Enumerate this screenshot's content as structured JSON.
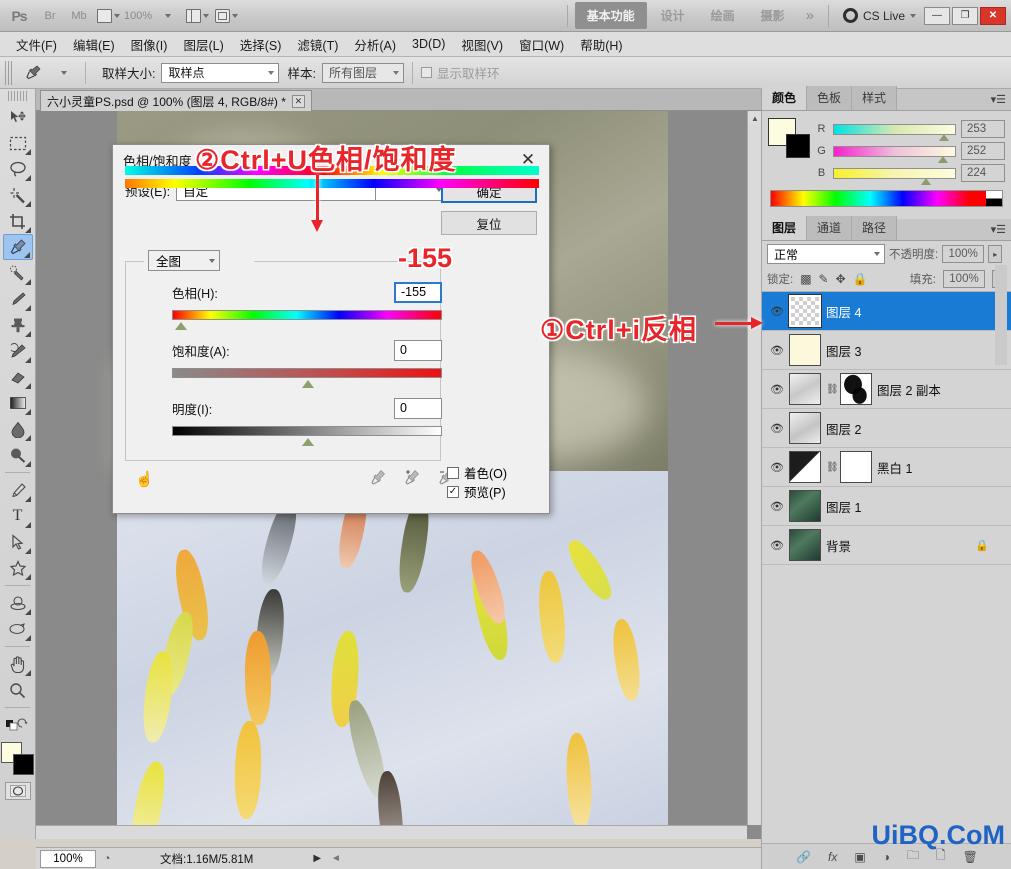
{
  "app": {
    "logo": "Ps",
    "title_buttons": [
      "Br",
      "Mb"
    ],
    "zoom_label": "100%",
    "workspaces": [
      {
        "label": "基本功能",
        "active": true
      },
      {
        "label": "设计",
        "active": false
      },
      {
        "label": "绘画",
        "active": false
      },
      {
        "label": "摄影",
        "active": false
      }
    ],
    "more_workspaces": "»",
    "cs_live": "CS Live",
    "window_buttons": {
      "minimize": "—",
      "maximize": "❐",
      "close": "✕"
    }
  },
  "menubar": {
    "items": [
      "文件(F)",
      "编辑(E)",
      "图像(I)",
      "图层(L)",
      "选择(S)",
      "滤镜(T)",
      "分析(A)",
      "3D(D)",
      "视图(V)",
      "窗口(W)",
      "帮助(H)"
    ]
  },
  "options_bar": {
    "tool_icon": "eyedropper-icon",
    "sample_size_label": "取样大小:",
    "sample_size_value": "取样点",
    "sample_label": "样本:",
    "sample_value": "所有图层",
    "show_ring_label": "显示取样环",
    "show_ring_checked": false
  },
  "document": {
    "tab_title": "六小灵童PS.psd @ 100% (图层 4, RGB/8#) *",
    "close_glyph": "✕"
  },
  "toolbox": {
    "tools": [
      {
        "name": "move-tool",
        "glyph": "✥",
        "selected": false,
        "has_more": false
      },
      {
        "name": "marquee-tool",
        "glyph": "▭",
        "selected": false,
        "has_more": true
      },
      {
        "name": "lasso-tool",
        "glyph": "◌",
        "selected": false,
        "has_more": true
      },
      {
        "name": "magic-wand-tool",
        "glyph": "✳",
        "selected": false,
        "has_more": true
      },
      {
        "name": "crop-tool",
        "glyph": "⌗",
        "selected": false,
        "has_more": true
      },
      {
        "name": "eyedropper-tool",
        "glyph": "⚲",
        "selected": true,
        "has_more": true
      },
      {
        "name": "healing-brush-tool",
        "glyph": "✒",
        "selected": false,
        "has_more": true
      },
      {
        "name": "brush-tool",
        "glyph": "🖌",
        "selected": false,
        "has_more": true
      },
      {
        "name": "clone-stamp-tool",
        "glyph": "⎈",
        "selected": false,
        "has_more": true
      },
      {
        "name": "history-brush-tool",
        "glyph": "✎",
        "selected": false,
        "has_more": true
      },
      {
        "name": "eraser-tool",
        "glyph": "▰",
        "selected": false,
        "has_more": true
      },
      {
        "name": "gradient-tool",
        "glyph": "▤",
        "selected": false,
        "has_more": true
      },
      {
        "name": "blur-tool",
        "glyph": "💧",
        "selected": false,
        "has_more": true
      },
      {
        "name": "dodge-tool",
        "glyph": "●",
        "selected": false,
        "has_more": true
      },
      {
        "name": "pen-tool",
        "glyph": "✑",
        "selected": false,
        "has_more": true
      },
      {
        "name": "type-tool",
        "glyph": "T",
        "selected": false,
        "has_more": true
      },
      {
        "name": "path-selection-tool",
        "glyph": "➤",
        "selected": false,
        "has_more": true
      },
      {
        "name": "custom-shape-tool",
        "glyph": "✦",
        "selected": false,
        "has_more": true
      },
      {
        "name": "rotate-3d-tool",
        "glyph": "◓",
        "selected": false,
        "has_more": true
      },
      {
        "name": "camera-3d-tool",
        "glyph": "◎",
        "selected": false,
        "has_more": true
      },
      {
        "name": "hand-tool",
        "glyph": "✋",
        "selected": false,
        "has_more": true
      },
      {
        "name": "zoom-tool",
        "glyph": "🔍",
        "selected": false,
        "has_more": false
      }
    ],
    "foreground_color": "#FDFCE0",
    "background_color": "#000000",
    "quick_mask_glyph": "◯"
  },
  "dialog": {
    "title": "色相/饱和度",
    "close_glyph": "✕",
    "preset_label": "预设(E):",
    "preset_value": "自定",
    "ok_label": "确定",
    "reset_label": "复位",
    "channel_value": "全图",
    "sliders": [
      {
        "name": "hue",
        "label": "色相(H):",
        "value": "-155",
        "focused": true
      },
      {
        "name": "saturation",
        "label": "饱和度(A):",
        "value": "0",
        "focused": false
      },
      {
        "name": "lightness",
        "label": "明度(I):",
        "value": "0",
        "focused": false
      }
    ],
    "colorize_label": "着色(O)",
    "colorize_checked": false,
    "preview_label": "预览(P)",
    "preview_checked": true,
    "preview_glyph": "✓"
  },
  "annotations": {
    "step1": "①Ctrl+i反相",
    "step2": "②Ctrl+U色相/饱和度",
    "hue_callout": "-155"
  },
  "color_panel": {
    "tabs": [
      {
        "label": "颜色",
        "active": true
      },
      {
        "label": "色板",
        "active": false
      },
      {
        "label": "样式",
        "active": false
      }
    ],
    "channels": [
      {
        "letter": "R",
        "value": "253",
        "pos": 93
      },
      {
        "letter": "G",
        "value": "252",
        "pos": 92
      },
      {
        "letter": "B",
        "value": "224",
        "pos": 80
      }
    ],
    "foreground_color": "#FDFCE0",
    "background_color": "#000000"
  },
  "layers_panel": {
    "tabs": [
      {
        "label": "图层",
        "active": true
      },
      {
        "label": "通道",
        "active": false
      },
      {
        "label": "路径",
        "active": false
      }
    ],
    "blend_mode": "正常",
    "opacity_label": "不透明度:",
    "opacity_value": "100%",
    "lock_label": "锁定:",
    "lock_icons": [
      "transparency-lock-icon",
      "brush-lock-icon",
      "move-lock-icon",
      "all-lock-icon"
    ],
    "fill_label": "填充:",
    "fill_value": "100%",
    "layers": [
      {
        "name": "图层 4",
        "selected": true,
        "visible": true,
        "thumb": "transparent",
        "has_mask": false,
        "locked": false
      },
      {
        "name": "图层 3",
        "selected": false,
        "visible": true,
        "thumb": "cream",
        "has_mask": false,
        "locked": false
      },
      {
        "name": "图层 2 副本",
        "selected": false,
        "visible": true,
        "thumb": "gray",
        "has_mask": true,
        "locked": false
      },
      {
        "name": "图层 2",
        "selected": false,
        "visible": true,
        "thumb": "gray",
        "has_mask": false,
        "locked": false
      },
      {
        "name": "黑白 1",
        "selected": false,
        "visible": true,
        "thumb": "bw-adjust",
        "has_mask": true,
        "locked": false
      },
      {
        "name": "图层 1",
        "selected": false,
        "visible": true,
        "thumb": "green",
        "has_mask": false,
        "locked": false
      },
      {
        "name": "背景",
        "selected": false,
        "visible": true,
        "thumb": "green",
        "has_mask": false,
        "locked": true
      }
    ],
    "bottom_icons": [
      "link-icon",
      "fx-icon",
      "mask-icon",
      "adjustment-icon",
      "group-icon",
      "new-layer-icon",
      "delete-icon"
    ]
  },
  "status_bar": {
    "zoom": "100%",
    "doc_label": "文档:1.16M/5.81M",
    "arrow_glyph": "▶"
  },
  "watermark": "UiBQ.CoM",
  "colors": {
    "accent_blue": "#1a7bd4",
    "annotation_red": "#e8252a",
    "watermark_blue": "#1f63c4",
    "close_red": "#d9362b"
  }
}
